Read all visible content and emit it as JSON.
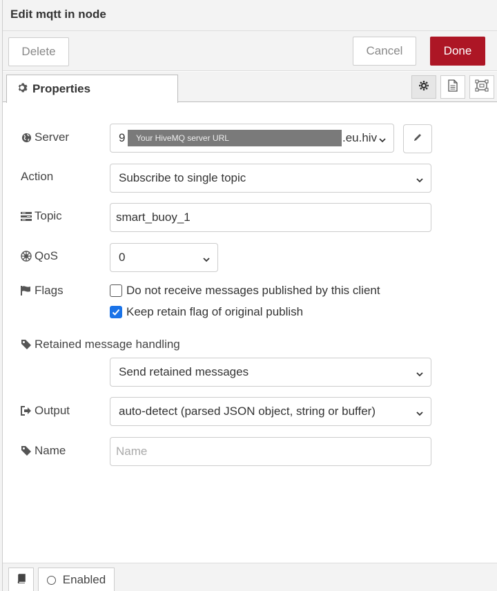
{
  "title": "Edit mqtt in node",
  "toolbar": {
    "delete_label": "Delete",
    "cancel_label": "Cancel",
    "done_label": "Done",
    "done_color": "#ad1625"
  },
  "tabs": {
    "properties_label": "Properties",
    "icons": [
      "gear-icon",
      "description-icon",
      "appearance-icon"
    ]
  },
  "form": {
    "server": {
      "label": "Server",
      "value_prefix": "9",
      "value_suffix": ".eu.hiv",
      "mask_text": "Your HiveMQ server URL"
    },
    "action": {
      "label": "Action",
      "value": "Subscribe to single topic"
    },
    "topic": {
      "label": "Topic",
      "value": "smart_buoy_1"
    },
    "qos": {
      "label": "QoS",
      "value": "0"
    },
    "flags": {
      "label": "Flags",
      "no_local": {
        "label": "Do not receive messages published by this client",
        "checked": false
      },
      "retain_as_published": {
        "label": "Keep retain flag of original publish",
        "checked": true
      }
    },
    "retain_handling": {
      "label": "Retained message handling",
      "value": "Send retained messages"
    },
    "output": {
      "label": "Output",
      "value": "auto-detect (parsed JSON object, string or buffer)"
    },
    "name": {
      "label": "Name",
      "placeholder": "Name"
    }
  },
  "footer": {
    "enabled_label": "Enabled"
  }
}
